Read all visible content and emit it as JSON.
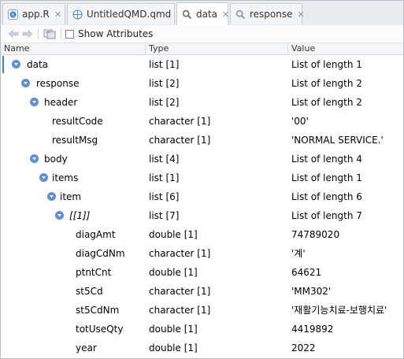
{
  "tabs": [
    {
      "label": "app.R",
      "icon": "r-file-icon",
      "active": false
    },
    {
      "label": "UntitledQMD.qmd",
      "icon": "quarto-file-icon",
      "active": false
    },
    {
      "label": "data",
      "icon": "search-icon",
      "active": true
    },
    {
      "label": "response",
      "icon": "search-icon",
      "active": false
    }
  ],
  "toolbar": {
    "show_attributes_label": "Show Attributes",
    "show_attributes_checked": false
  },
  "columns": {
    "name": "Name",
    "type": "Type",
    "value": "Value"
  },
  "rows": [
    {
      "name": "data",
      "type": "list [1]",
      "value": "List of length 1",
      "expandable": true
    },
    {
      "name": "response",
      "type": "list [2]",
      "value": "List of length 2",
      "expandable": true
    },
    {
      "name": "header",
      "type": "list [2]",
      "value": "List of length 2",
      "expandable": true
    },
    {
      "name": "resultCode",
      "type": "character [1]",
      "value": "'00'",
      "expandable": false
    },
    {
      "name": "resultMsg",
      "type": "character [1]",
      "value": "'NORMAL SERVICE.'",
      "expandable": false
    },
    {
      "name": "body",
      "type": "list [4]",
      "value": "List of length 4",
      "expandable": true
    },
    {
      "name": "items",
      "type": "list [1]",
      "value": "List of length 1",
      "expandable": true
    },
    {
      "name": "item",
      "type": "list [6]",
      "value": "List of length 6",
      "expandable": true
    },
    {
      "name": "[[1]]",
      "type": "list [7]",
      "value": "List of length 7",
      "expandable": true
    },
    {
      "name": "diagAmt",
      "type": "double [1]",
      "value": "74789020",
      "expandable": false
    },
    {
      "name": "diagCdNm",
      "type": "character [1]",
      "value": "'계'",
      "expandable": false
    },
    {
      "name": "ptntCnt",
      "type": "double [1]",
      "value": "64621",
      "expandable": false
    },
    {
      "name": "st5Cd",
      "type": "character [1]",
      "value": "'MM302'",
      "expandable": false
    },
    {
      "name": "st5CdNm",
      "type": "character [1]",
      "value": "'재활기능치료-보행치료'",
      "expandable": false
    },
    {
      "name": "totUseQty",
      "type": "double [1]",
      "value": "4419892",
      "expandable": false
    },
    {
      "name": "year",
      "type": "double [1]",
      "value": "2022",
      "expandable": false
    }
  ],
  "colors": {
    "toggle": "#5b8fd6",
    "focus_bar": "#2e86de"
  }
}
